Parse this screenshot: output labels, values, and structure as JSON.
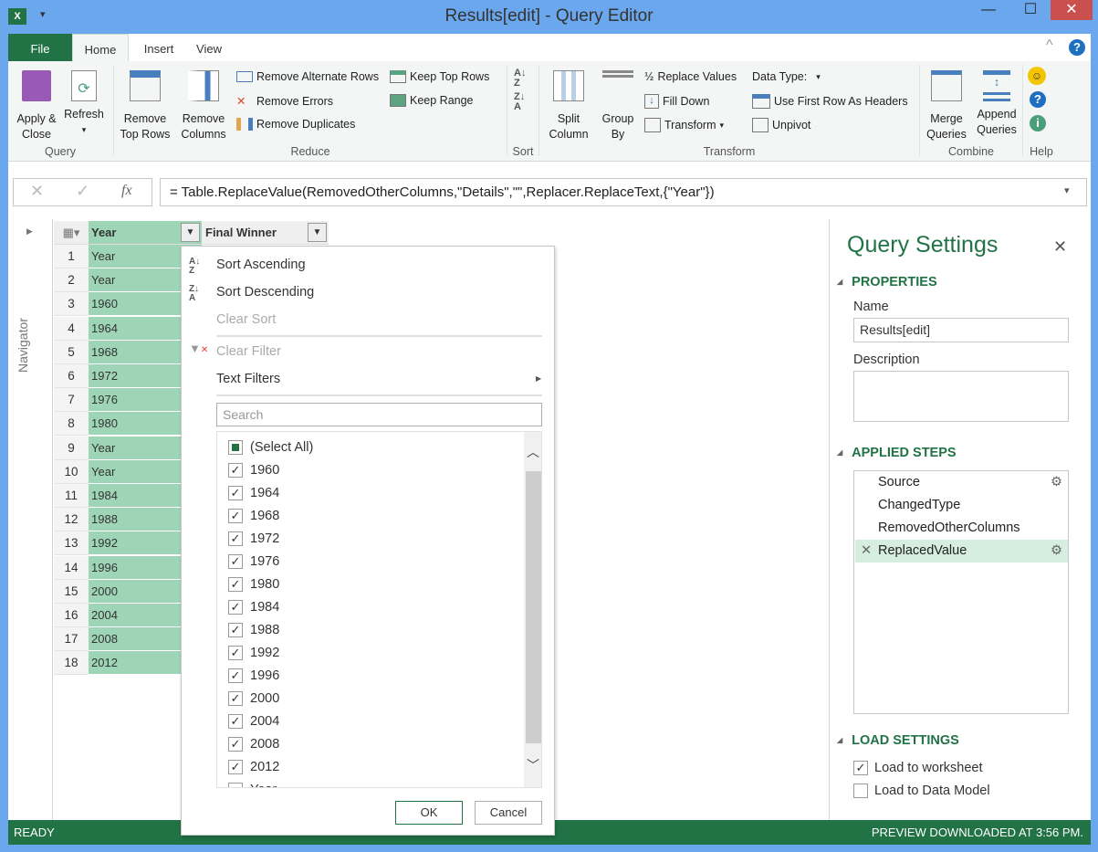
{
  "window": {
    "title": "Results[edit] - Query Editor",
    "minimize": "—",
    "maximize": "☐",
    "close": "✕"
  },
  "tabs": [
    {
      "label": "File"
    },
    {
      "label": "Home"
    },
    {
      "label": "Insert"
    },
    {
      "label": "View"
    }
  ],
  "ribbon": {
    "query": {
      "apply_close": "Apply & Close",
      "refresh": "Refresh",
      "label": "Query"
    },
    "reduce": {
      "remove_top_rows": "Remove Top Rows",
      "remove_columns": "Remove Columns",
      "remove_alternate_rows": "Remove Alternate Rows",
      "remove_errors": "Remove Errors",
      "remove_duplicates": "Remove Duplicates",
      "keep_top_rows": "Keep Top Rows",
      "keep_range": "Keep Range",
      "label": "Reduce"
    },
    "sort": {
      "label": "Sort"
    },
    "transform": {
      "split_column": "Split Column",
      "group_by": "Group By",
      "replace_values": "Replace Values",
      "fill_down": "Fill Down",
      "transform": "Transform",
      "data_type": "Data Type:",
      "use_first_row": "Use First Row As Headers",
      "unpivot": "Unpivot",
      "label": "Transform"
    },
    "combine": {
      "merge": "Merge Queries",
      "append": "Append Queries",
      "label": "Combine"
    },
    "help": {
      "label": "Help"
    }
  },
  "formula": {
    "text": "= Table.ReplaceValue(RemovedOtherColumns,\"Details\",\"\",Replacer.ReplaceText,{\"Year\"})",
    "fx": "fx",
    "cancel": "✕",
    "commit": "✓"
  },
  "navigator": {
    "label": "Navigator"
  },
  "grid": {
    "columns": [
      "Year",
      "Final Winner"
    ],
    "rows": [
      "Year",
      "Year",
      "1960",
      "1964",
      "1968",
      "1972",
      "1976",
      "1980",
      "Year",
      "Year",
      "1984",
      "1988",
      "1992",
      "1996",
      "2000",
      "2004",
      "2008",
      "2012"
    ]
  },
  "filter_menu": {
    "sort_asc": "Sort Ascending",
    "sort_desc": "Sort Descending",
    "clear_sort": "Clear Sort",
    "clear_filter": "Clear Filter",
    "text_filters": "Text Filters",
    "search_placeholder": "Search",
    "items": [
      {
        "label": "(Select All)",
        "state": "partial"
      },
      {
        "label": "1960",
        "state": "checked"
      },
      {
        "label": "1964",
        "state": "checked"
      },
      {
        "label": "1968",
        "state": "checked"
      },
      {
        "label": "1972",
        "state": "checked"
      },
      {
        "label": "1976",
        "state": "checked"
      },
      {
        "label": "1980",
        "state": "checked"
      },
      {
        "label": "1984",
        "state": "checked"
      },
      {
        "label": "1988",
        "state": "checked"
      },
      {
        "label": "1992",
        "state": "checked"
      },
      {
        "label": "1996",
        "state": "checked"
      },
      {
        "label": "2000",
        "state": "checked"
      },
      {
        "label": "2004",
        "state": "checked"
      },
      {
        "label": "2008",
        "state": "checked"
      },
      {
        "label": "2012",
        "state": "checked"
      },
      {
        "label": "Year",
        "state": "unchecked"
      }
    ],
    "ok": "OK",
    "cancel": "Cancel"
  },
  "query_settings": {
    "title": "Query Settings",
    "properties": "PROPERTIES",
    "name_label": "Name",
    "name_value": "Results[edit]",
    "description_label": "Description",
    "description_value": "",
    "applied_steps": "APPLIED STEPS",
    "steps": [
      {
        "label": "Source",
        "gear": true
      },
      {
        "label": "ChangedType",
        "gear": false
      },
      {
        "label": "RemovedOtherColumns",
        "gear": false
      },
      {
        "label": "ReplacedValue",
        "gear": true,
        "selected": true
      }
    ],
    "load_settings": "LOAD SETTINGS",
    "load_worksheet": "Load to worksheet",
    "load_worksheet_checked": true,
    "load_model": "Load to Data Model",
    "load_model_checked": false
  },
  "status": {
    "left": "READY",
    "right": "PREVIEW DOWNLOADED AT 3:56 PM."
  },
  "colors": {
    "accent": "#217346",
    "title_bar": "#6ba7ec",
    "selected_column": "#9fd5b7",
    "selected_step": "#d5eee0",
    "close": "#c9504f"
  }
}
